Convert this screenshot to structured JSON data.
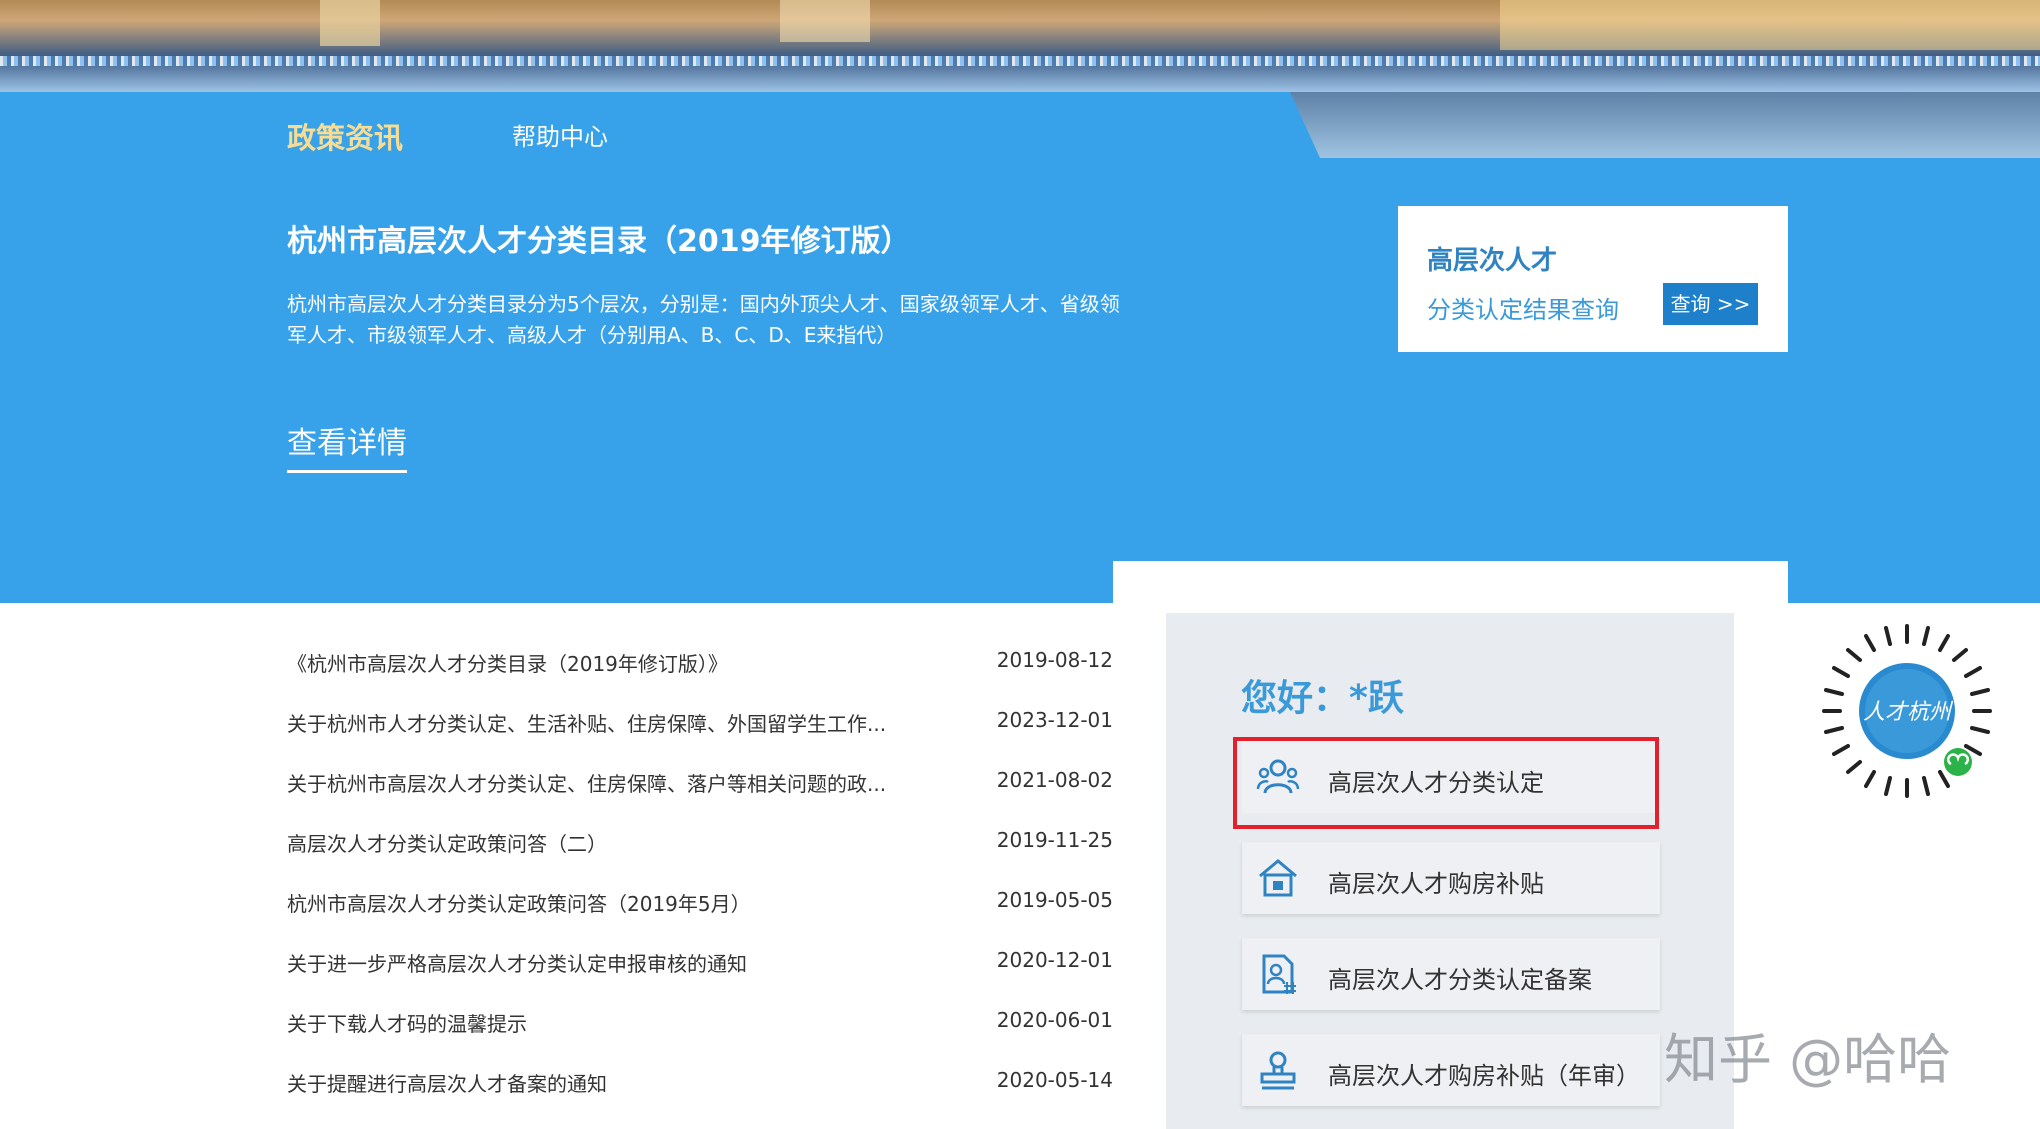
{
  "nav": {
    "items": [
      {
        "label": "政策资讯"
      },
      {
        "label": "帮助中心"
      }
    ]
  },
  "hero": {
    "title": "杭州市高层次人才分类目录（2019年修订版）",
    "description": "杭州市高层次人才分类目录分为5个层次，分别是：国内外顶尖人才、国家级领军人才、省级领军人才、市级领军人才、高级人才（分别用A、B、C、D、E来指代）",
    "detail_link": "查看详情"
  },
  "query_card": {
    "title": "高层次人才",
    "subtitle": "分类认定结果查询",
    "button": "查询 >>"
  },
  "news": [
    {
      "title": "《杭州市高层次人才分类目录（2019年修订版）》",
      "date": "2019-08-12"
    },
    {
      "title": "关于杭州市人才分类认定、生活补贴、住房保障、外国留学生工作...",
      "date": "2023-12-01"
    },
    {
      "title": "关于杭州市高层次人才分类认定、住房保障、落户等相关问题的政...",
      "date": "2021-08-02"
    },
    {
      "title": "高层次人才分类认定政策问答（二）",
      "date": "2019-11-25"
    },
    {
      "title": "杭州市高层次人才分类认定政策问答（2019年5月）",
      "date": "2019-05-05"
    },
    {
      "title": "关于进一步严格高层次人才分类认定申报审核的通知",
      "date": "2020-12-01"
    },
    {
      "title": "关于下载人才码的温馨提示",
      "date": "2020-06-01"
    },
    {
      "title": "关于提醒进行高层次人才备案的通知",
      "date": "2020-05-14"
    }
  ],
  "login": {
    "greeting": "您好：*跃",
    "services": [
      {
        "label": "高层次人才分类认定",
        "icon": "people-icon",
        "highlighted": true
      },
      {
        "label": "高层次人才购房补贴",
        "icon": "house-icon"
      },
      {
        "label": "高层次人才分类认定备案",
        "icon": "document-user-icon"
      },
      {
        "label": "高层次人才购房补贴（年审）",
        "icon": "stamp-icon"
      }
    ]
  },
  "qr": {
    "logo_text": "人才杭州"
  },
  "watermark": "知乎 @哈哈",
  "colors": {
    "primary_blue": "#37a2e9",
    "nav_active": "#f7dc94",
    "highlight_red": "#e3202c",
    "button_blue": "#1e7fcb"
  }
}
